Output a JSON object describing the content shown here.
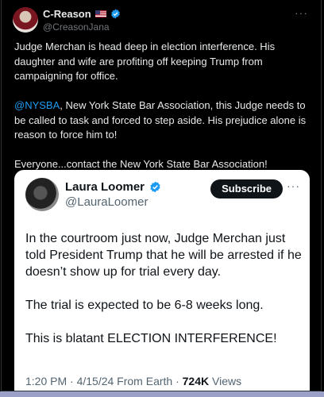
{
  "post": {
    "author_name": "C-Reason",
    "author_handle": "@CreasonJana",
    "more_label": "···",
    "paragraph1": "Judge Merchan is head deep in election interference. His daughter and wife are profiting off keeping Trump from campaigning for office.",
    "mention": "@NYSBA",
    "paragraph2_rest": ", New York State Bar Association, this Judge needs to be called to task and forced to step aside. His prejudice alone is reason to force him to!",
    "paragraph3": "Everyone...contact the New York State Bar Association!"
  },
  "quote": {
    "author_name": "Laura Loomer",
    "author_handle": "@LauraLoomer",
    "subscribe_label": "Subscribe",
    "more_label": "···",
    "paragraph1": "In the courtroom just now, Judge Merchan just told President Trump that he will be arrested if he doesn’t show up for trial every day.",
    "paragraph2": "The trial is expected to be 6-8 weeks long.",
    "paragraph3": "This is blatant ELECTION INTERFERENCE!",
    "meta_prefix": "1:20 PM · 4/15/24 From Earth · ",
    "views_count": "724K",
    "views_label": " Views"
  },
  "colors": {
    "accent": "#1d9bf0",
    "background": "#000000",
    "quote_background": "#ffffff"
  }
}
